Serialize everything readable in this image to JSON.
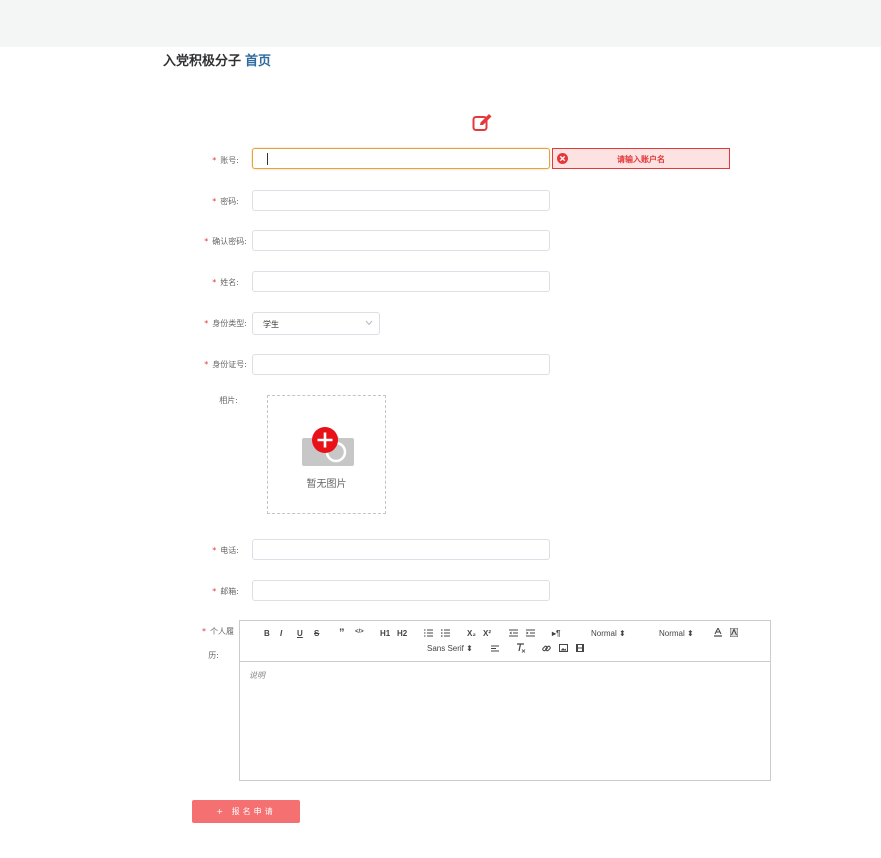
{
  "breadcrumb": {
    "current": "入党积极分子",
    "home": "首页"
  },
  "form": {
    "account": {
      "label": "账号:",
      "value": "",
      "error": "请输入账户名"
    },
    "password": {
      "label": "密码:",
      "value": ""
    },
    "confirm_password": {
      "label": "确认密码:",
      "value": ""
    },
    "name": {
      "label": "姓名:",
      "value": ""
    },
    "identity_type": {
      "label": "身份类型:",
      "selected": "学生"
    },
    "id_number": {
      "label": "身份证号:",
      "value": ""
    },
    "photo": {
      "label": "相片:",
      "empty_text": "暂无图片"
    },
    "phone": {
      "label": "电话:",
      "value": ""
    },
    "email": {
      "label": "邮箱:",
      "value": ""
    },
    "resume": {
      "label_line1": "个人履",
      "label_line2": "历:",
      "placeholder": "说明"
    }
  },
  "required_mark": "*",
  "editor_toolbar": {
    "bold": "B",
    "italic": "I",
    "underline": "U",
    "strike": "S",
    "blockquote": "”",
    "code": "</>",
    "h1": "H1",
    "h2": "H2",
    "subscript": "X₂",
    "superscript": "X²",
    "rtl": "▸¶",
    "size_select": "Normal",
    "header_select": "Normal",
    "font_select": "Sans Serif"
  },
  "submit_label": "+ 报名申请",
  "colors": {
    "accent_red": "#e4393c",
    "submit_bg": "#f57070",
    "link_blue": "#2e6a9e",
    "focus_orange": "#e6a23c"
  }
}
